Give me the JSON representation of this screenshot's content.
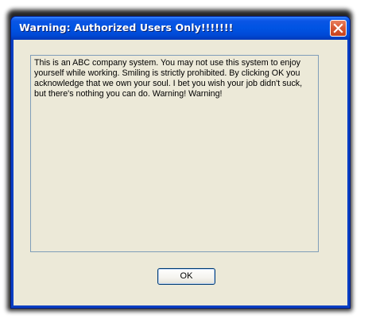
{
  "window": {
    "title": "Warning: Authorized Users Only!!!!!!!",
    "close_icon": "close-icon",
    "accent_color": "#0054e3",
    "close_color": "#d85a36"
  },
  "dialog": {
    "message": "This is an ABC company system. You may not use this system to enjoy yourself while working. Smiling is strictly prohibited. By clicking OK you acknowledge that we own your soul. I bet you wish your job didn't suck, but there's nothing you can do. Warning! Warning!",
    "ok_label": "OK"
  }
}
